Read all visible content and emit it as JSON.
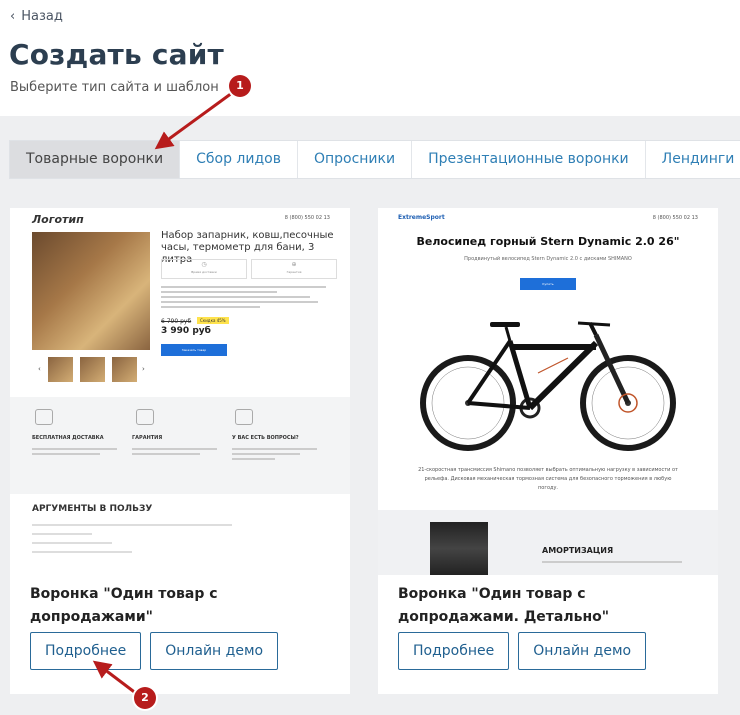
{
  "nav": {
    "back_label": "Назад"
  },
  "header": {
    "title": "Создать сайт",
    "subtitle": "Выберите тип сайта и шаблон"
  },
  "tabs": [
    {
      "label": "Товарные воронки",
      "active": true
    },
    {
      "label": "Сбор лидов",
      "active": false
    },
    {
      "label": "Опросники",
      "active": false
    },
    {
      "label": "Презентационные воронки",
      "active": false
    },
    {
      "label": "Лендинги",
      "active": false
    }
  ],
  "cards": [
    {
      "title": "Воронка \"Один товар с допродажами\"",
      "details_label": "Подробнее",
      "demo_label": "Онлайн демо",
      "preview": {
        "logo": "Логотип",
        "phone": "8 (800) 550 02 13",
        "product_name": "Набор запарник, ковш,песочные часы, термометр для бани, 3 литра",
        "old_price": "6 790 руб",
        "sale_badge": "Скидка 45%",
        "price": "3 990 руб",
        "buy_label": "Заказать товар",
        "feature_box_1": "Время доставки",
        "feature_box_2": "Гарантия",
        "features": [
          {
            "title": "БЕСПЛАТНАЯ ДОСТАВКА"
          },
          {
            "title": "ГАРАНТИЯ"
          },
          {
            "title": "У ВАС ЕСТЬ ВОПРОСЫ?"
          }
        ],
        "args_title": "АРГУМЕНТЫ В ПОЛЬЗУ"
      }
    },
    {
      "title": "Воронка \"Один товар с допродажами. Детально\"",
      "details_label": "Подробнее",
      "demo_label": "Онлайн демо",
      "preview": {
        "logo": "ExtremeSport",
        "phone": "8 (800) 550 02 13",
        "product_title": "Велосипед горный Stern Dynamic 2.0 26\"",
        "subtitle": "Продвинутый велосипед Stern Dynamic 2.0 с дисками SHIMANO",
        "buy_label": "Купить",
        "description": "21-скоростная трансмиссия Shimano позволяет выбрать оптимальную нагрузку в зависимости от рельефа. Дисковая механическая тормозная система для безопасного торможения в любую погоду.",
        "section_title": "АМОРТИЗАЦИЯ"
      }
    }
  ],
  "annotations": [
    {
      "number": "1"
    },
    {
      "number": "2"
    }
  ],
  "colors": {
    "accent": "#2f7fb5",
    "button_border": "#2a6a99",
    "marker": "#b71c1c",
    "panel_bg": "#eeeff1"
  }
}
